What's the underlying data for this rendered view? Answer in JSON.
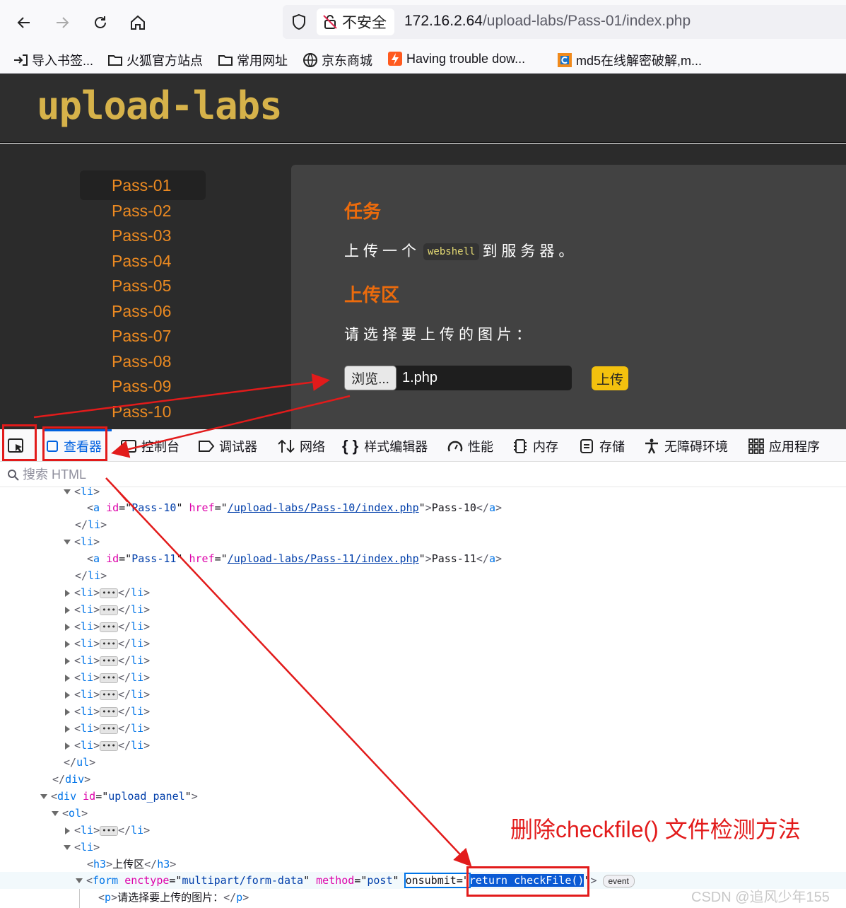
{
  "browser": {
    "security_label": "不安全",
    "url_host": "172.16.2.64",
    "url_path": "/upload-labs/Pass-01/index.php",
    "bookmarks": [
      "导入书签...",
      "火狐官方站点",
      "常用网址",
      "京东商城",
      "Having trouble dow...",
      "md5在线解密破解,m..."
    ]
  },
  "page": {
    "logo": "upload-labs",
    "menu": [
      "Pass-01",
      "Pass-02",
      "Pass-03",
      "Pass-04",
      "Pass-05",
      "Pass-06",
      "Pass-07",
      "Pass-08",
      "Pass-09",
      "Pass-10"
    ],
    "task_heading": "任务",
    "task_text_before": "上传一个",
    "task_code": "webshell",
    "task_text_after": "到服务器。",
    "upload_heading": "上传区",
    "upload_prompt": "请选择要上传的图片：",
    "browse_label": "浏览...",
    "file_name": "1.php",
    "upload_button": "上传"
  },
  "devtools": {
    "tabs": [
      "查看器",
      "控制台",
      "调试器",
      "网络",
      "样式编辑器",
      "性能",
      "内存",
      "存储",
      "无障碍环境",
      "应用程序"
    ],
    "search_placeholder": "搜索 HTML",
    "tree": {
      "li": "li",
      "a": "a",
      "ul": "ul",
      "div": "div",
      "ol": "ol",
      "h3": "h3",
      "form": "form",
      "p": "p",
      "attr_id": "id",
      "attr_href": "href",
      "attr_enctype": "enctype",
      "attr_method": "method",
      "attr_onsubmit": "onsubmit",
      "pass10_id": "Pass-10",
      "pass10_href": "/upload-labs/Pass-10/index.php",
      "pass10_text": "Pass-10",
      "pass11_id": "Pass-11",
      "pass11_href": "/upload-labs/Pass-11/index.php",
      "pass11_text": "Pass-11",
      "div_id": "upload_panel",
      "h3_text": "上传区",
      "enctype_val": "multipart/form-data",
      "method_val": "post",
      "onsubmit_val": "return checkFile()",
      "p_text": "请选择要上传的图片：",
      "event_badge": "event"
    }
  },
  "annotation": {
    "text": "删除checkfile()  文件检测方法",
    "color": "#e21b1b"
  },
  "watermark": "CSDN @追风少年155"
}
